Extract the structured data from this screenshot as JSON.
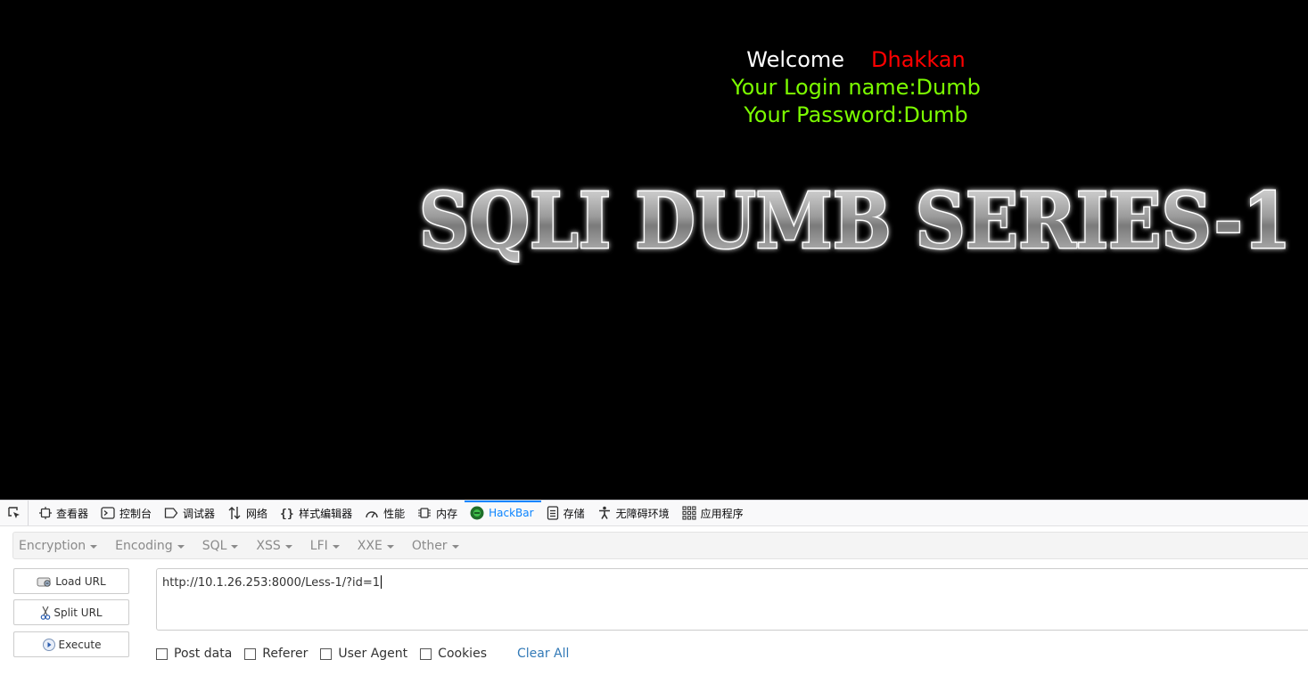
{
  "page": {
    "welcome_word": "Welcome",
    "welcome_user": "Dhakkan",
    "login_line": "Your Login name:Dumb",
    "password_line": "Your Password:Dumb",
    "banner_text": "SQLI DUMB SERIES-1"
  },
  "devtools": {
    "tabs": [
      {
        "label": "查看器",
        "icon": "inspector-icon"
      },
      {
        "label": "控制台",
        "icon": "console-icon"
      },
      {
        "label": "调试器",
        "icon": "debugger-icon"
      },
      {
        "label": "网络",
        "icon": "network-icon"
      },
      {
        "label": "样式编辑器",
        "icon": "style-editor-icon"
      },
      {
        "label": "性能",
        "icon": "performance-icon"
      },
      {
        "label": "内存",
        "icon": "memory-icon"
      },
      {
        "label": "HackBar",
        "icon": "hackbar-icon"
      },
      {
        "label": "存储",
        "icon": "storage-icon"
      },
      {
        "label": "无障碍环境",
        "icon": "accessibility-icon"
      },
      {
        "label": "应用程序",
        "icon": "application-icon"
      }
    ],
    "active_tab": "HackBar"
  },
  "hackbar": {
    "menu": [
      "Encryption",
      "Encoding",
      "SQL",
      "XSS",
      "LFI",
      "XXE",
      "Other"
    ],
    "load_url": "Load URL",
    "split_url": "Split URL",
    "execute": "Execute",
    "url_value": "http://10.1.26.253:8000/Less-1/?id=1",
    "options": [
      "Post data",
      "Referer",
      "User Agent",
      "Cookies"
    ],
    "clear_all": "Clear All"
  },
  "colors": {
    "welcome": "#ffffff",
    "username": "#ff0000",
    "info": "#7cfc00",
    "active_tab": "#0a84ff",
    "link": "#337ab7"
  }
}
